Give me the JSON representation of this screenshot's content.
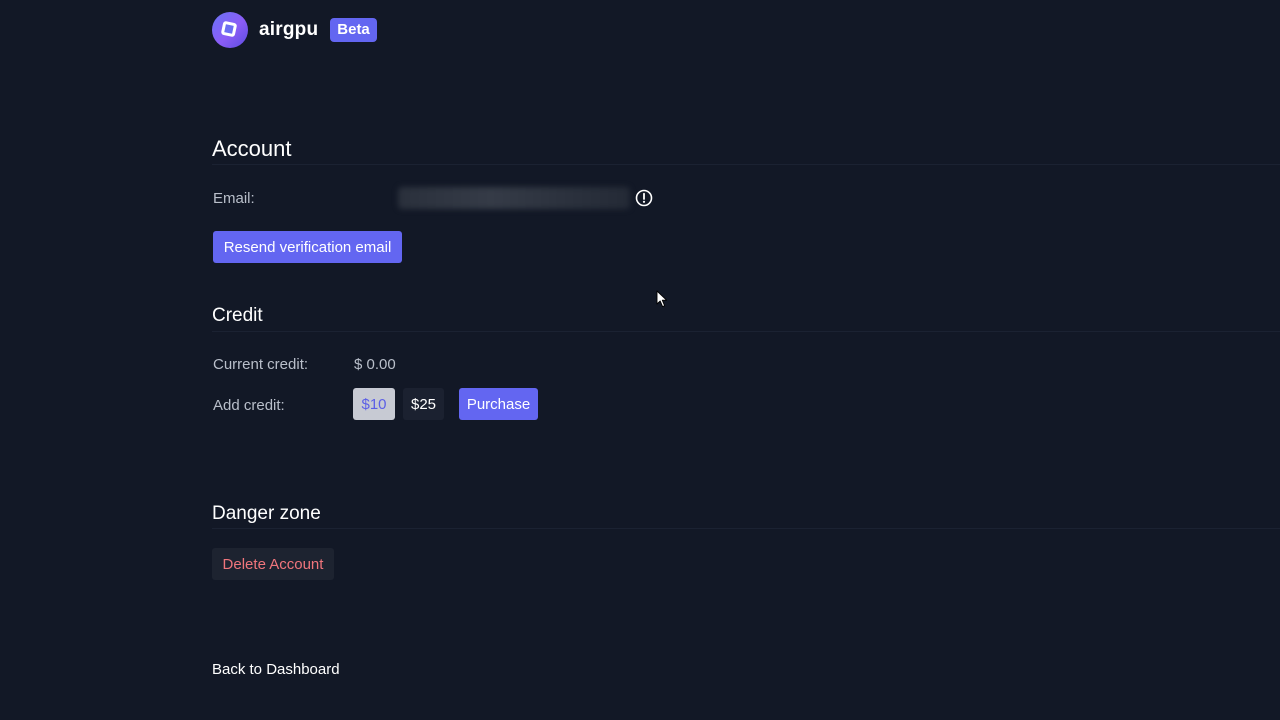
{
  "header": {
    "app_name": "airgpu",
    "badge": "Beta"
  },
  "account": {
    "title": "Account",
    "email_label": "Email:",
    "email_value_hidden": true,
    "resend_button": "Resend verification email"
  },
  "credit": {
    "title": "Credit",
    "current_label": "Current credit:",
    "current_value": "$ 0.00",
    "add_label": "Add credit:",
    "options": [
      "$10",
      "$25"
    ],
    "selected_option": "$10",
    "purchase_button": "Purchase"
  },
  "danger": {
    "title": "Danger zone",
    "delete_button": "Delete Account"
  },
  "footer": {
    "back_link": "Back to Dashboard"
  },
  "colors": {
    "background": "#121826",
    "accent": "#6366f1",
    "danger_text": "#f0757c"
  },
  "icons": {
    "logo": "airgpu-logo-icon",
    "email_warning": "alert-circle-icon"
  }
}
